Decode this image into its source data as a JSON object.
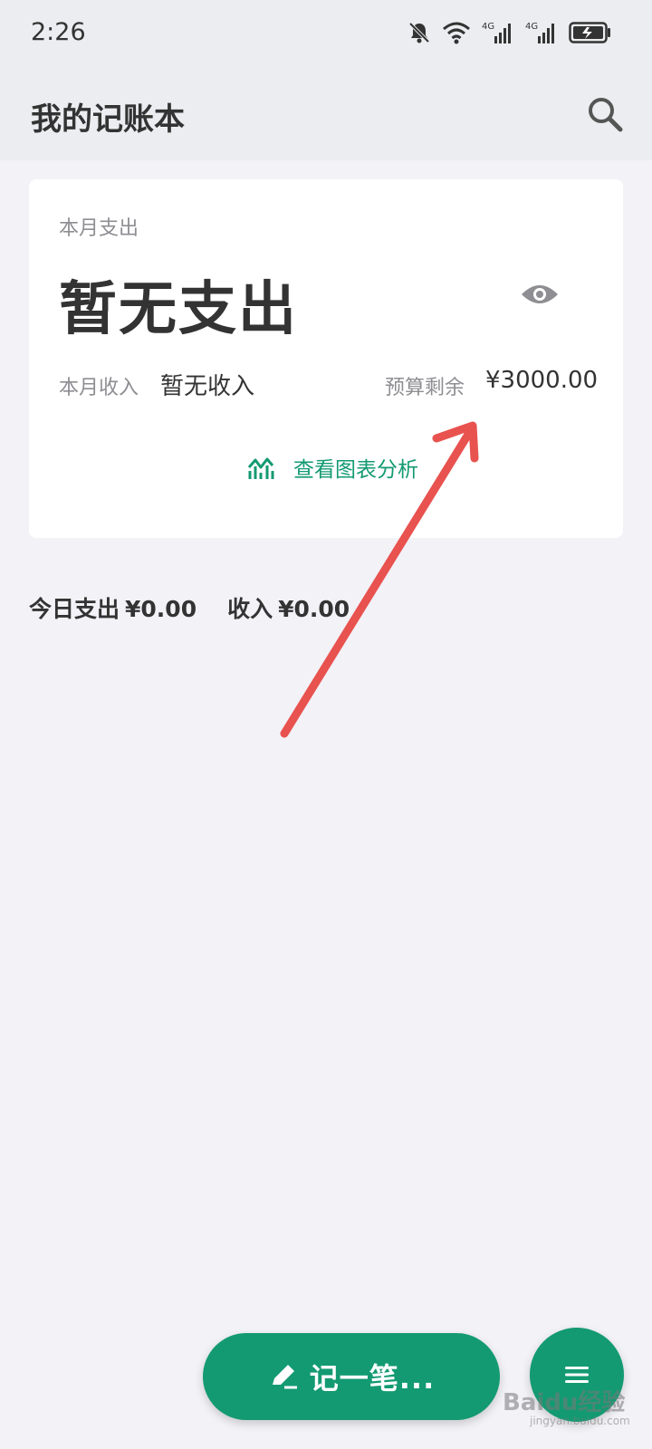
{
  "status_bar": {
    "time": "2:26",
    "network_1": "4G",
    "network_2": "4G",
    "icons": [
      "bell-off-icon",
      "wifi-icon",
      "signal-icon",
      "signal-icon",
      "battery-icon"
    ]
  },
  "app_bar": {
    "title": "我的记账本",
    "search_icon": "search-icon"
  },
  "summary_card": {
    "month_expense_label": "本月支出",
    "month_expense_value": "暂无支出",
    "visibility_icon": "eye-icon",
    "month_income_label": "本月收入",
    "month_income_value": "暂无收入",
    "budget_left_label": "预算剩余",
    "budget_left_value": "¥3000.00",
    "chart_link_label": "查看图表分析",
    "chart_icon": "chart-icon"
  },
  "today": {
    "expense_label": "今日支出",
    "expense_value": "¥0.00",
    "income_label": "收入",
    "income_value": "¥0.00"
  },
  "fab": {
    "record_label": "记一笔...",
    "record_icon": "pen-icon",
    "menu_icon": "menu-icon"
  },
  "watermark": {
    "brand": "Baidu经验",
    "url": "jingyan.baidu.com"
  },
  "colors": {
    "accent": "#139a72",
    "header_bg": "#ebedf0",
    "page_bg": "#f2f2f7",
    "annotation_arrow": "#e8524f"
  }
}
